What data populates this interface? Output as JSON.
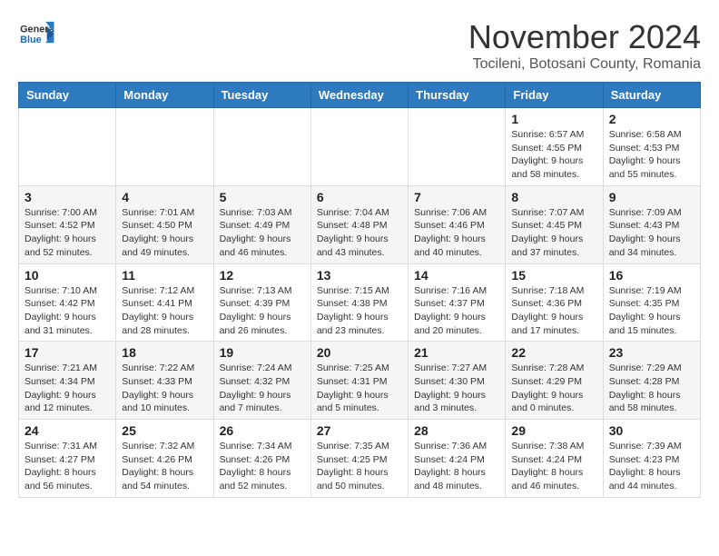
{
  "header": {
    "logo_line1": "General",
    "logo_line2": "Blue",
    "month": "November 2024",
    "location": "Tocileni, Botosani County, Romania"
  },
  "weekdays": [
    "Sunday",
    "Monday",
    "Tuesday",
    "Wednesday",
    "Thursday",
    "Friday",
    "Saturday"
  ],
  "weeks": [
    [
      {
        "day": "",
        "info": ""
      },
      {
        "day": "",
        "info": ""
      },
      {
        "day": "",
        "info": ""
      },
      {
        "day": "",
        "info": ""
      },
      {
        "day": "",
        "info": ""
      },
      {
        "day": "1",
        "info": "Sunrise: 6:57 AM\nSunset: 4:55 PM\nDaylight: 9 hours\nand 58 minutes."
      },
      {
        "day": "2",
        "info": "Sunrise: 6:58 AM\nSunset: 4:53 PM\nDaylight: 9 hours\nand 55 minutes."
      }
    ],
    [
      {
        "day": "3",
        "info": "Sunrise: 7:00 AM\nSunset: 4:52 PM\nDaylight: 9 hours\nand 52 minutes."
      },
      {
        "day": "4",
        "info": "Sunrise: 7:01 AM\nSunset: 4:50 PM\nDaylight: 9 hours\nand 49 minutes."
      },
      {
        "day": "5",
        "info": "Sunrise: 7:03 AM\nSunset: 4:49 PM\nDaylight: 9 hours\nand 46 minutes."
      },
      {
        "day": "6",
        "info": "Sunrise: 7:04 AM\nSunset: 4:48 PM\nDaylight: 9 hours\nand 43 minutes."
      },
      {
        "day": "7",
        "info": "Sunrise: 7:06 AM\nSunset: 4:46 PM\nDaylight: 9 hours\nand 40 minutes."
      },
      {
        "day": "8",
        "info": "Sunrise: 7:07 AM\nSunset: 4:45 PM\nDaylight: 9 hours\nand 37 minutes."
      },
      {
        "day": "9",
        "info": "Sunrise: 7:09 AM\nSunset: 4:43 PM\nDaylight: 9 hours\nand 34 minutes."
      }
    ],
    [
      {
        "day": "10",
        "info": "Sunrise: 7:10 AM\nSunset: 4:42 PM\nDaylight: 9 hours\nand 31 minutes."
      },
      {
        "day": "11",
        "info": "Sunrise: 7:12 AM\nSunset: 4:41 PM\nDaylight: 9 hours\nand 28 minutes."
      },
      {
        "day": "12",
        "info": "Sunrise: 7:13 AM\nSunset: 4:39 PM\nDaylight: 9 hours\nand 26 minutes."
      },
      {
        "day": "13",
        "info": "Sunrise: 7:15 AM\nSunset: 4:38 PM\nDaylight: 9 hours\nand 23 minutes."
      },
      {
        "day": "14",
        "info": "Sunrise: 7:16 AM\nSunset: 4:37 PM\nDaylight: 9 hours\nand 20 minutes."
      },
      {
        "day": "15",
        "info": "Sunrise: 7:18 AM\nSunset: 4:36 PM\nDaylight: 9 hours\nand 17 minutes."
      },
      {
        "day": "16",
        "info": "Sunrise: 7:19 AM\nSunset: 4:35 PM\nDaylight: 9 hours\nand 15 minutes."
      }
    ],
    [
      {
        "day": "17",
        "info": "Sunrise: 7:21 AM\nSunset: 4:34 PM\nDaylight: 9 hours\nand 12 minutes."
      },
      {
        "day": "18",
        "info": "Sunrise: 7:22 AM\nSunset: 4:33 PM\nDaylight: 9 hours\nand 10 minutes."
      },
      {
        "day": "19",
        "info": "Sunrise: 7:24 AM\nSunset: 4:32 PM\nDaylight: 9 hours\nand 7 minutes."
      },
      {
        "day": "20",
        "info": "Sunrise: 7:25 AM\nSunset: 4:31 PM\nDaylight: 9 hours\nand 5 minutes."
      },
      {
        "day": "21",
        "info": "Sunrise: 7:27 AM\nSunset: 4:30 PM\nDaylight: 9 hours\nand 3 minutes."
      },
      {
        "day": "22",
        "info": "Sunrise: 7:28 AM\nSunset: 4:29 PM\nDaylight: 9 hours\nand 0 minutes."
      },
      {
        "day": "23",
        "info": "Sunrise: 7:29 AM\nSunset: 4:28 PM\nDaylight: 8 hours\nand 58 minutes."
      }
    ],
    [
      {
        "day": "24",
        "info": "Sunrise: 7:31 AM\nSunset: 4:27 PM\nDaylight: 8 hours\nand 56 minutes."
      },
      {
        "day": "25",
        "info": "Sunrise: 7:32 AM\nSunset: 4:26 PM\nDaylight: 8 hours\nand 54 minutes."
      },
      {
        "day": "26",
        "info": "Sunrise: 7:34 AM\nSunset: 4:26 PM\nDaylight: 8 hours\nand 52 minutes."
      },
      {
        "day": "27",
        "info": "Sunrise: 7:35 AM\nSunset: 4:25 PM\nDaylight: 8 hours\nand 50 minutes."
      },
      {
        "day": "28",
        "info": "Sunrise: 7:36 AM\nSunset: 4:24 PM\nDaylight: 8 hours\nand 48 minutes."
      },
      {
        "day": "29",
        "info": "Sunrise: 7:38 AM\nSunset: 4:24 PM\nDaylight: 8 hours\nand 46 minutes."
      },
      {
        "day": "30",
        "info": "Sunrise: 7:39 AM\nSunset: 4:23 PM\nDaylight: 8 hours\nand 44 minutes."
      }
    ]
  ]
}
